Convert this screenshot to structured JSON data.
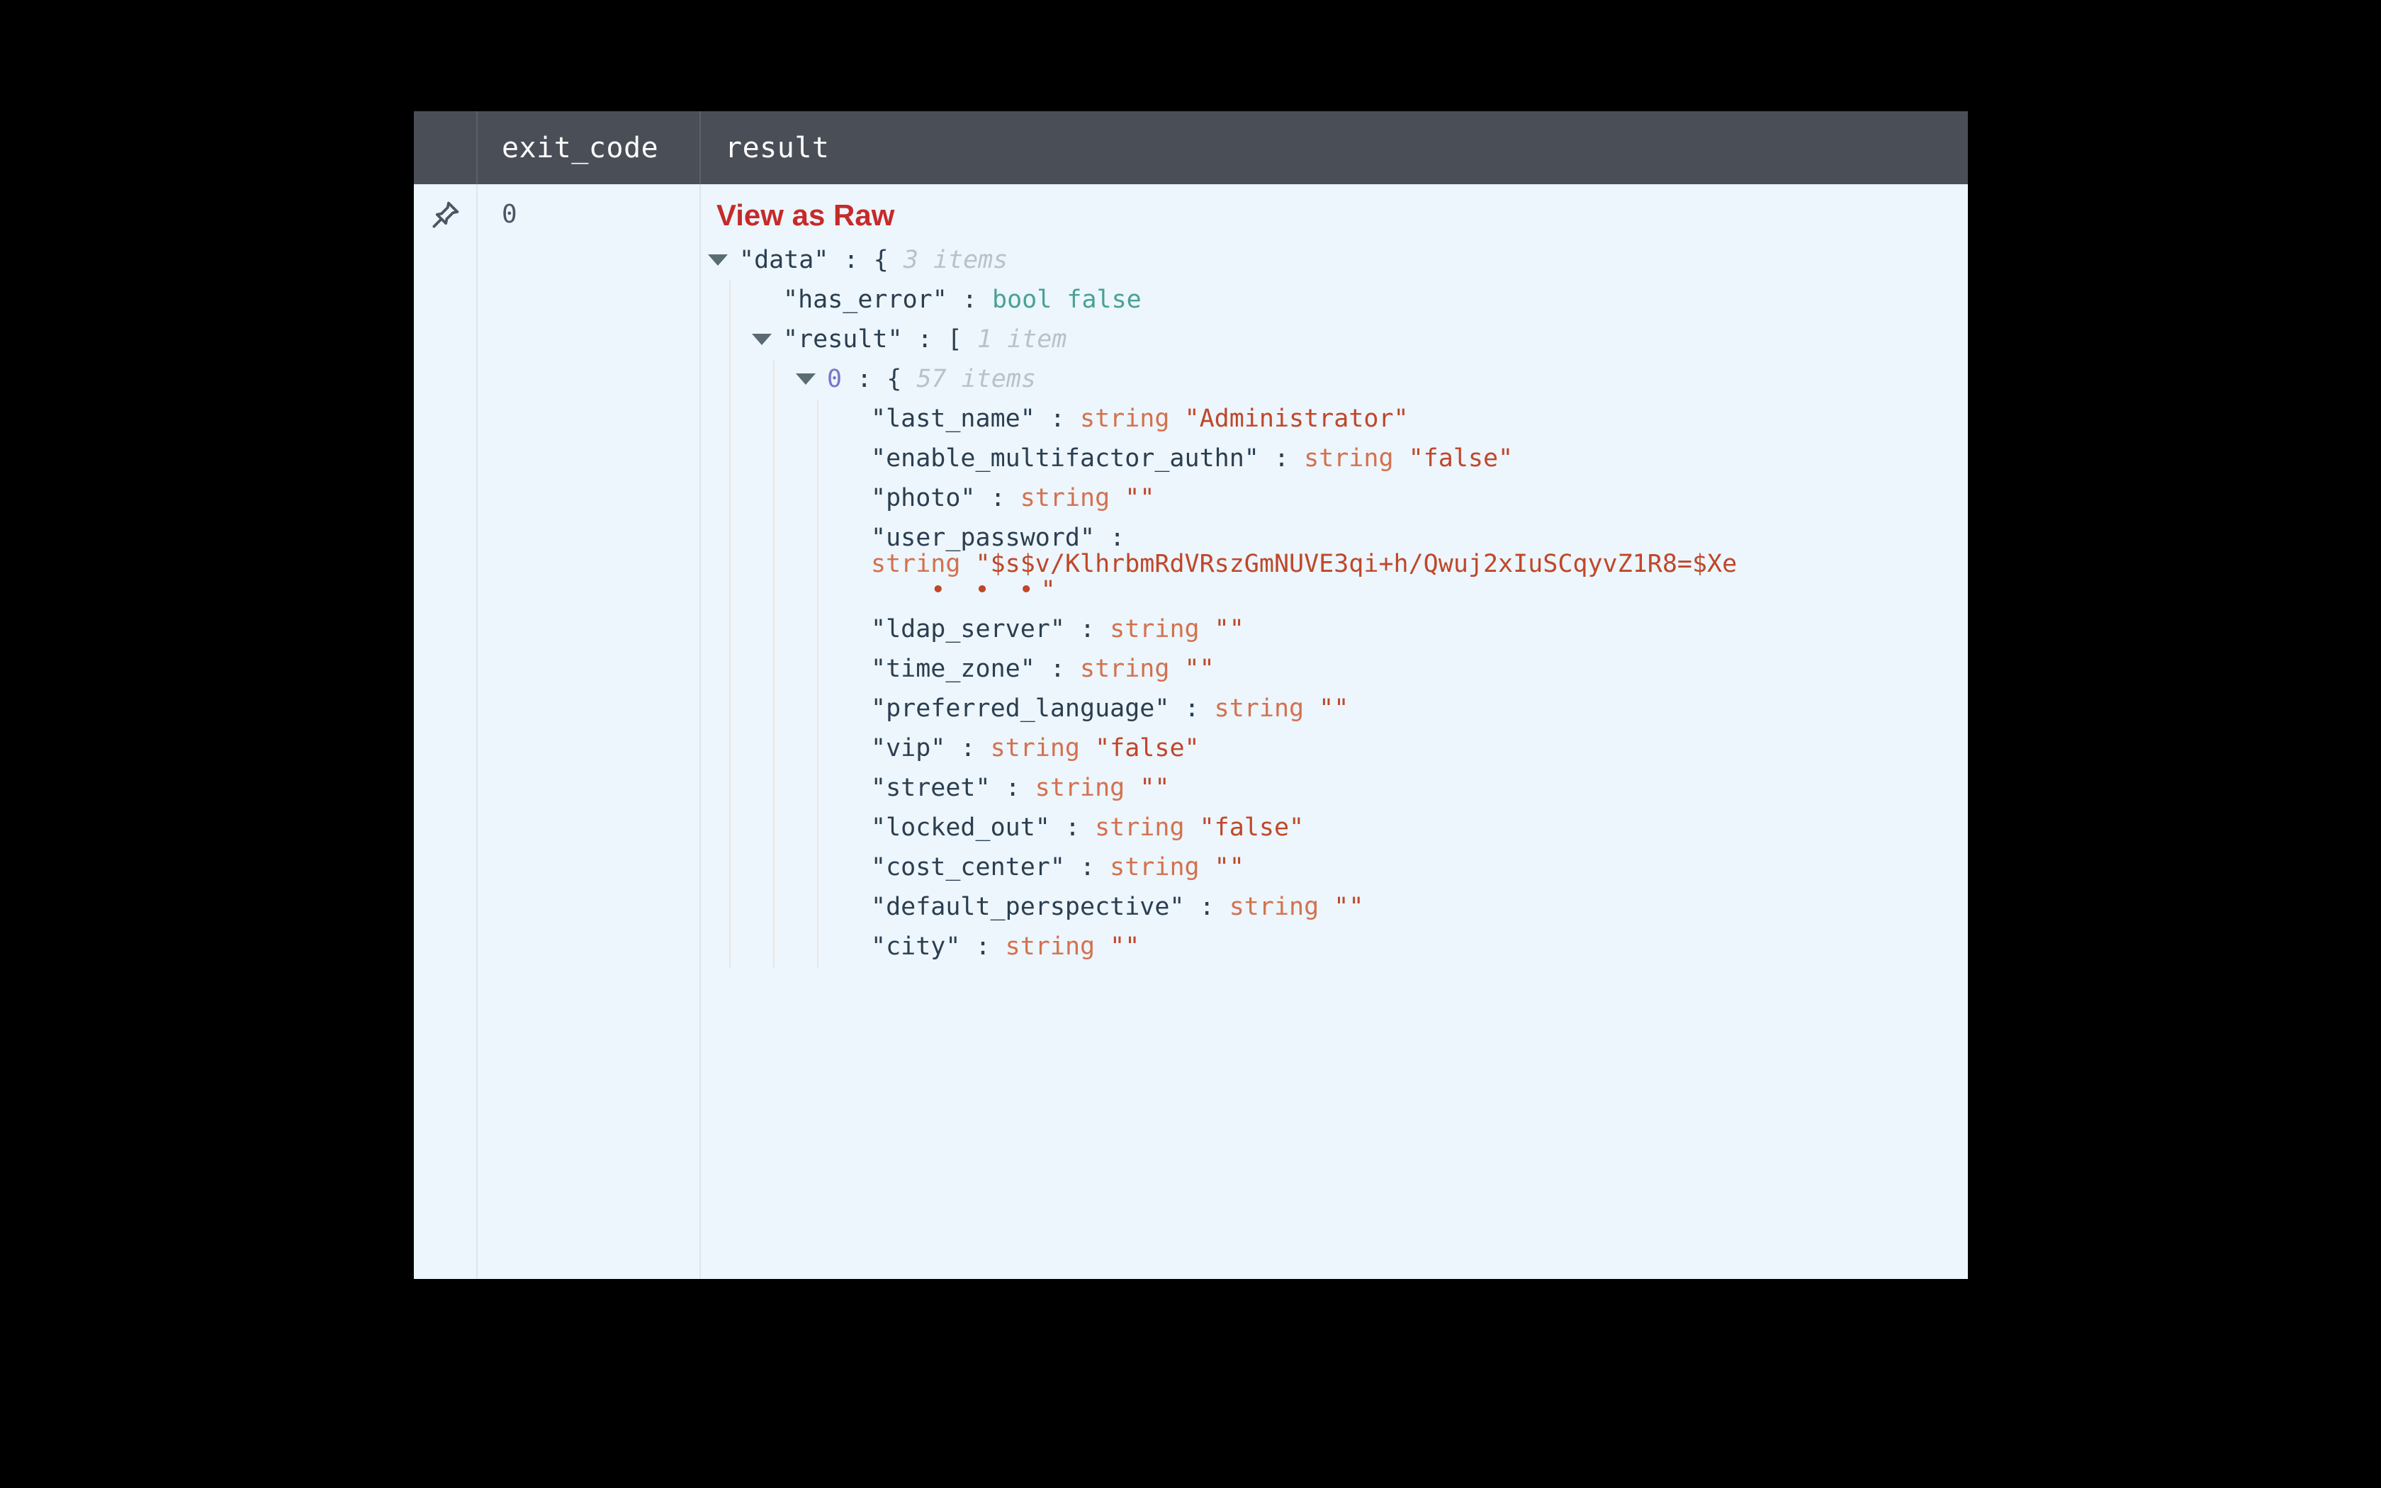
{
  "table": {
    "columns": [
      {
        "id": "pin",
        "label": ""
      },
      {
        "id": "exit_code",
        "label": "exit_code"
      },
      {
        "id": "result",
        "label": "result"
      }
    ],
    "row": {
      "pin_icon": "pin-icon",
      "exit_code": "0"
    }
  },
  "result_cell": {
    "view_as_raw_label": "View as Raw"
  },
  "colors": {
    "panel_background": "#ecf6fc",
    "header_background": "#4a4e57",
    "header_text": "#ffffff",
    "view_raw": "#c62a2a",
    "key": "#2c3e50",
    "type_label": "#d4714e",
    "string_value": "#c0472a",
    "bool_value": "#4aa196",
    "meta_count": "#b9c2c6",
    "array_index": "#7b74c9",
    "indent_rail": "#f0e2e0"
  },
  "json_tree": {
    "rows": [
      {
        "id": "data",
        "depth": 0,
        "caret": "down",
        "key": "\"data\"",
        "sep": " : ",
        "brace": "{",
        "meta": "3 items"
      },
      {
        "id": "has_error",
        "depth": 1,
        "caret": "none",
        "key": "\"has_error\"",
        "sep": " : ",
        "type": "bool",
        "bool_value": "false"
      },
      {
        "id": "result",
        "depth": 1,
        "caret": "down",
        "key": "\"result\"",
        "sep": " : ",
        "brace": "[",
        "meta": "1 item"
      },
      {
        "id": "index0",
        "depth": 2,
        "caret": "down",
        "index": "0",
        "sep": " : ",
        "brace": "{",
        "meta": "57 items"
      },
      {
        "id": "last_name",
        "depth": 3,
        "caret": "none",
        "key": "\"last_name\"",
        "sep": " : ",
        "type": "string",
        "value": "\"Administrator\""
      },
      {
        "id": "enable_multifactor_authn",
        "depth": 3,
        "caret": "none",
        "key": "\"enable_multifactor_authn\"",
        "sep": " : ",
        "type": "string",
        "value": "\"false\""
      },
      {
        "id": "photo",
        "depth": 3,
        "caret": "none",
        "key": "\"photo\"",
        "sep": " : ",
        "type": "string",
        "value": "\"\""
      },
      {
        "id": "user_password",
        "depth": 3,
        "caret": "none",
        "key": "\"user_password\"",
        "sep": " : ",
        "type": "string",
        "value": "\"$s$v/KlhrbmRdVRszGmNUVE3qi+h/Qwuj2xIuSCqyvZ1R8=$Xe",
        "truncated": true,
        "ellipsis": "• • •",
        "value_tail": "\"",
        "wrapped": true
      },
      {
        "id": "ldap_server",
        "depth": 3,
        "caret": "none",
        "key": "\"ldap_server\"",
        "sep": " : ",
        "type": "string",
        "value": "\"\""
      },
      {
        "id": "time_zone",
        "depth": 3,
        "caret": "none",
        "key": "\"time_zone\"",
        "sep": " : ",
        "type": "string",
        "value": "\"\""
      },
      {
        "id": "preferred_language",
        "depth": 3,
        "caret": "none",
        "key": "\"preferred_language\"",
        "sep": " : ",
        "type": "string",
        "value": "\"\""
      },
      {
        "id": "vip",
        "depth": 3,
        "caret": "none",
        "key": "\"vip\"",
        "sep": " : ",
        "type": "string",
        "value": "\"false\""
      },
      {
        "id": "street",
        "depth": 3,
        "caret": "none",
        "key": "\"street\"",
        "sep": " : ",
        "type": "string",
        "value": "\"\""
      },
      {
        "id": "locked_out",
        "depth": 3,
        "caret": "none",
        "key": "\"locked_out\"",
        "sep": " : ",
        "type": "string",
        "value": "\"false\""
      },
      {
        "id": "cost_center",
        "depth": 3,
        "caret": "none",
        "key": "\"cost_center\"",
        "sep": " : ",
        "type": "string",
        "value": "\"\""
      },
      {
        "id": "default_perspective",
        "depth": 3,
        "caret": "none",
        "key": "\"default_perspective\"",
        "sep": " : ",
        "type": "string",
        "value": "\"\""
      },
      {
        "id": "city",
        "depth": 3,
        "caret": "none",
        "key": "\"city\"",
        "sep": " : ",
        "type": "string",
        "value": "\"\""
      }
    ]
  }
}
